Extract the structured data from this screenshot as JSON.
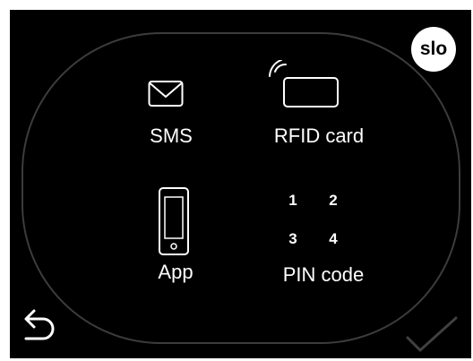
{
  "language_button": {
    "label": "slo"
  },
  "options": {
    "sms": {
      "label": "SMS",
      "icon": "envelope-icon"
    },
    "rfid": {
      "label": "RFID card",
      "icon": "rfid-card-icon"
    },
    "app": {
      "label": "App",
      "icon": "smartphone-icon"
    },
    "pin": {
      "label": "PIN code",
      "icon": "pin-keypad-icon",
      "digits": [
        "1",
        "2",
        "3",
        "4"
      ]
    }
  },
  "navigation": {
    "back_icon": "return-arrow-icon",
    "confirm_icon": "checkmark-icon"
  },
  "colors": {
    "background": "#000000",
    "foreground": "#ffffff",
    "outline": "#3c3c3c",
    "confirm_disabled": "#404040"
  }
}
